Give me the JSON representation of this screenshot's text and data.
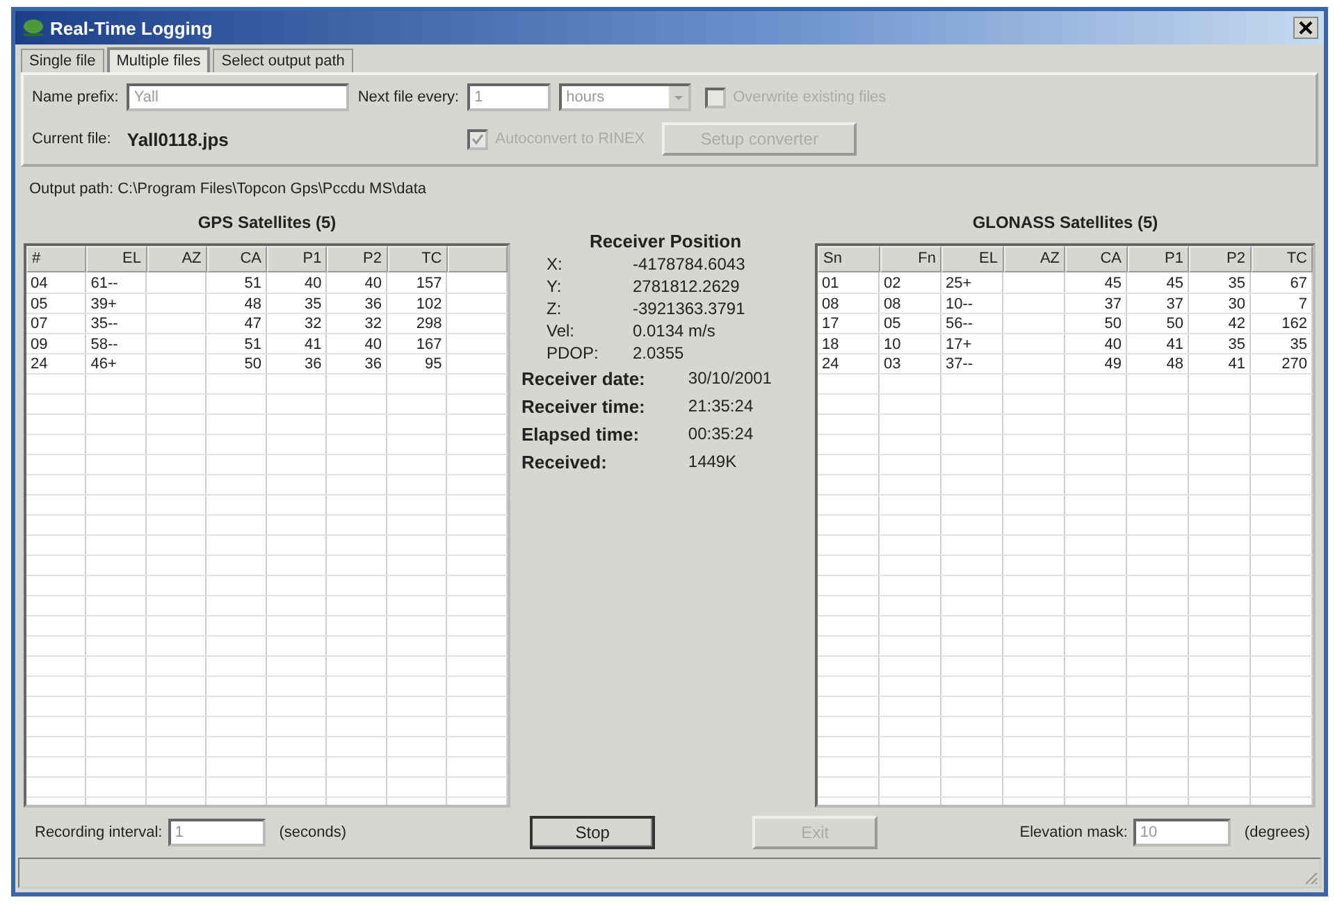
{
  "window": {
    "title": "Real-Time Logging"
  },
  "tabs": [
    {
      "label": "Single file",
      "selected": false
    },
    {
      "label": "Multiple files",
      "selected": true
    },
    {
      "label": "Select output path",
      "selected": false
    }
  ],
  "settings": {
    "name_prefix": {
      "label": "Name prefix:",
      "value": "Yall",
      "disabled": true
    },
    "next_file": {
      "label": "Next file every:",
      "value": "1",
      "disabled": true
    },
    "unit": {
      "value": "hours",
      "disabled": true
    },
    "overwrite": {
      "label": "Overwrite existing files",
      "checked": false,
      "disabled": true
    },
    "current_file": {
      "label": "Current file:",
      "value": "Yall0118.jps"
    },
    "autoconvert": {
      "label": "Autoconvert to RINEX",
      "checked": true,
      "disabled": true
    },
    "setup_button": {
      "label": "Setup converter",
      "disabled": true
    }
  },
  "output_path": "Output path: C:\\Program Files\\Topcon Gps\\Pccdu MS\\data",
  "gps": {
    "title": "GPS Satellites (5)",
    "columns": [
      "#",
      "EL",
      "AZ",
      "CA",
      "P1",
      "P2",
      "TC"
    ],
    "rows": [
      [
        "04",
        "61--",
        "",
        "51",
        "40",
        "40",
        "157"
      ],
      [
        "05",
        "39+",
        "",
        "48",
        "35",
        "36",
        "102"
      ],
      [
        "07",
        "35--",
        "",
        "47",
        "32",
        "32",
        "298"
      ],
      [
        "09",
        "58--",
        "",
        "51",
        "41",
        "40",
        "167"
      ],
      [
        "24",
        "46+",
        "",
        "50",
        "36",
        "36",
        "95"
      ]
    ]
  },
  "position": {
    "title": "Receiver Position",
    "fields": [
      {
        "label": "X:",
        "value": "-4178784.6043"
      },
      {
        "label": "Y:",
        "value": "2781812.2629"
      },
      {
        "label": "Z:",
        "value": "-3921363.3791"
      },
      {
        "label": "Vel:",
        "value": "0.0134 m/s"
      },
      {
        "label": "PDOP:",
        "value": "2.0355"
      }
    ],
    "info": [
      {
        "label": "Receiver date:",
        "value": "30/10/2001"
      },
      {
        "label": "Receiver time:",
        "value": "21:35:24"
      },
      {
        "label": "Elapsed time:",
        "value": "00:35:24"
      },
      {
        "label": "Received:",
        "value": "1449K"
      }
    ]
  },
  "glonass": {
    "title": "GLONASS Satellites (5)",
    "columns": [
      "Sn",
      "Fn",
      "EL",
      "AZ",
      "CA",
      "P1",
      "P2",
      "TC"
    ],
    "rows": [
      [
        "01",
        "02",
        "25+",
        "",
        "45",
        "45",
        "35",
        "67"
      ],
      [
        "08",
        "08",
        "10--",
        "",
        "37",
        "37",
        "30",
        "7"
      ],
      [
        "17",
        "05",
        "56--",
        "",
        "50",
        "50",
        "42",
        "162"
      ],
      [
        "18",
        "10",
        "17+",
        "",
        "40",
        "41",
        "35",
        "35"
      ],
      [
        "24",
        "03",
        "37--",
        "",
        "49",
        "48",
        "41",
        "270"
      ]
    ]
  },
  "bottom": {
    "recording_interval": {
      "label": "Recording interval:",
      "value": "1",
      "unit": "(seconds)",
      "disabled": true
    },
    "buttons": [
      {
        "label": "Stop",
        "disabled": false
      },
      {
        "label": "Exit",
        "disabled": true
      }
    ],
    "elevation_mask": {
      "label": "Elevation mask:",
      "value": "10",
      "unit": "(degrees)",
      "disabled": true
    }
  }
}
